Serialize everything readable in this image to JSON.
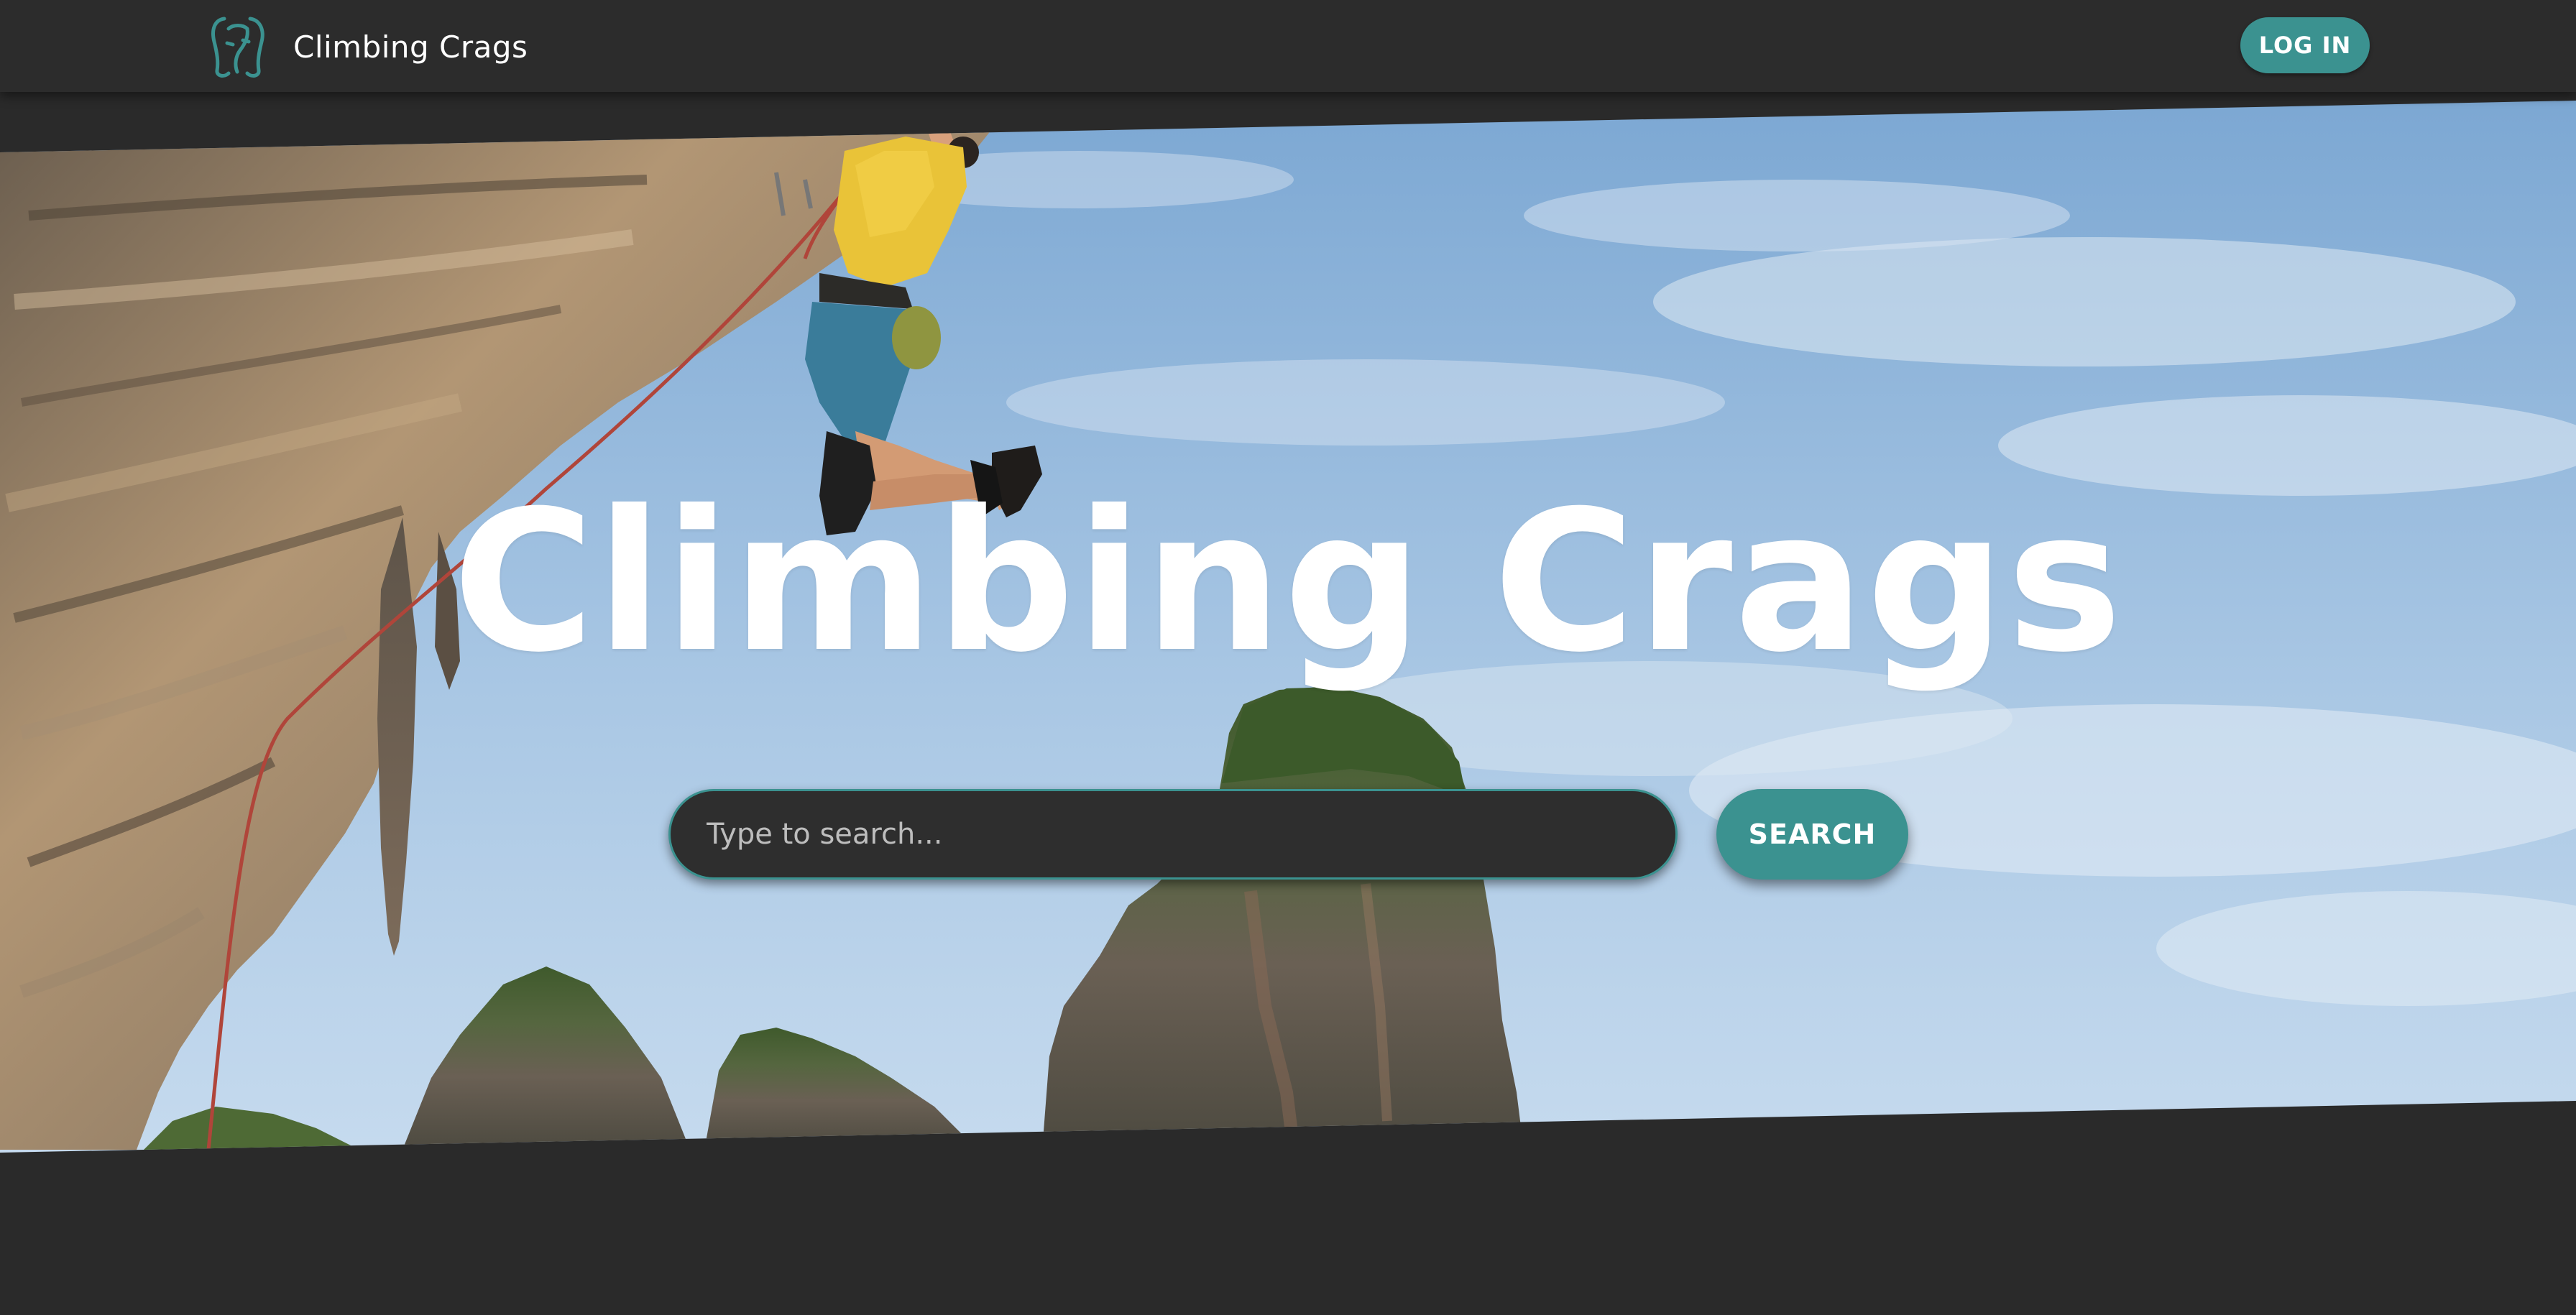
{
  "navbar": {
    "brand_name": "Climbing Crags",
    "login_label": "LOG IN"
  },
  "hero": {
    "title": "Climbing Crags",
    "search": {
      "placeholder": "Type to search...",
      "value": ""
    },
    "search_button_label": "SEARCH"
  },
  "colors": {
    "accent": "#3b9290",
    "background": "#2a2a2a",
    "navbar": "#2c2c2c",
    "text": "#ffffff"
  },
  "icons": {
    "brand_logo": "climbing-crags-logo-icon"
  }
}
